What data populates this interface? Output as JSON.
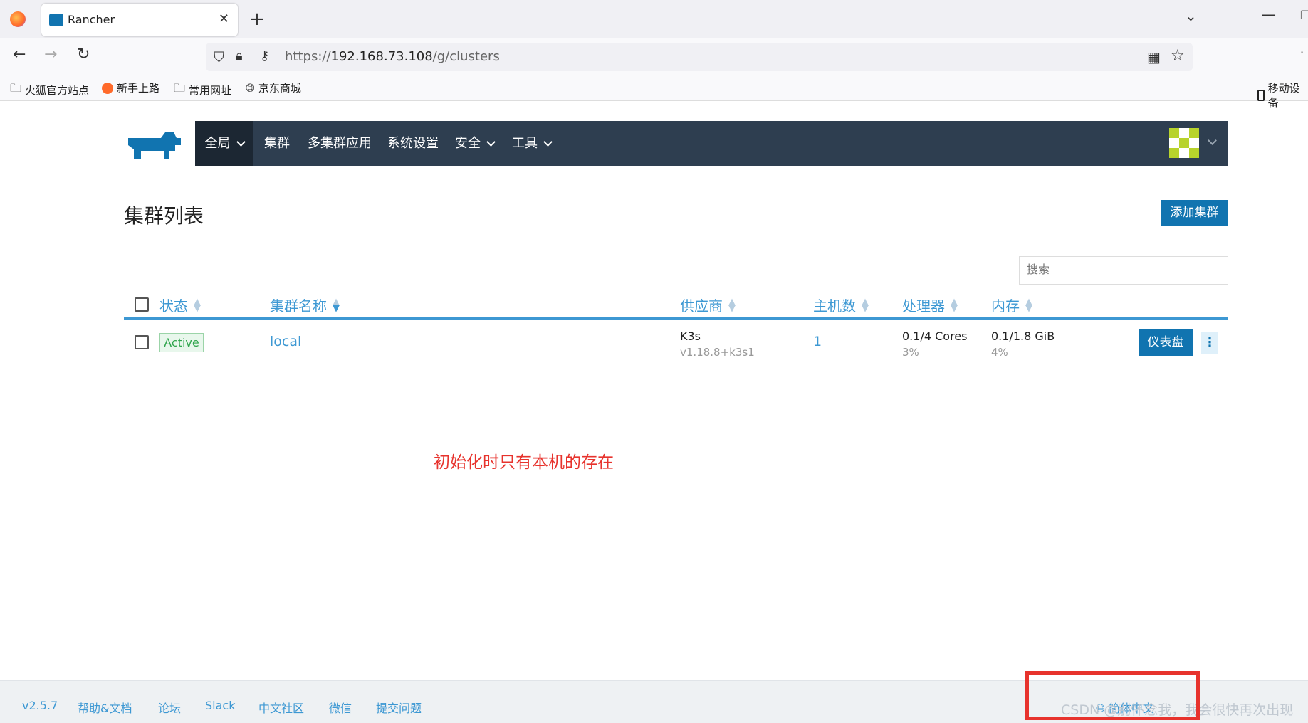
{
  "browser": {
    "tab_title": "Rancher",
    "url_prefix": "https://",
    "url_host": "192.168.73.108",
    "url_path": "/g/clusters",
    "bookmarks": [
      "火狐官方站点",
      "新手上路",
      "常用网址",
      "京东商城"
    ],
    "bookmark_right": "移动设备"
  },
  "nav": {
    "global": "全局",
    "clusters": "集群",
    "multicluster": "多集群应用",
    "settings": "系统设置",
    "security": "安全",
    "tools": "工具"
  },
  "page": {
    "title": "集群列表",
    "add_button": "添加集群",
    "search_placeholder": "搜索"
  },
  "table": {
    "headers": [
      "状态",
      "集群名称",
      "供应商",
      "主机数",
      "处理器",
      "内存"
    ],
    "rows": [
      {
        "status": "Active",
        "name": "local",
        "provider": "K3s",
        "provider_version": "v1.18.8+k3s1",
        "nodes": "1",
        "cpu": "0.1/4 Cores",
        "cpu_pct": "3%",
        "memory": "0.1/1.8 GiB",
        "memory_pct": "4%",
        "dashboard_button": "仪表盘",
        "more_button": "⋮"
      }
    ]
  },
  "annotation": "初始化时只有本机的存在",
  "footer": {
    "links": [
      "v2.5.7",
      "帮助&文档",
      "论坛",
      "Slack",
      "中文社区",
      "微信",
      "提交问题"
    ],
    "lang": "简体中文",
    "watermark": "CSDN @别怀念我，我会很快再次出现"
  },
  "colors": {
    "header_bg": "#2e3e50",
    "primary": "#1174b0",
    "link": "#3d98d3",
    "active_green": "#2fa54c",
    "annotation_red": "#e7332d"
  }
}
